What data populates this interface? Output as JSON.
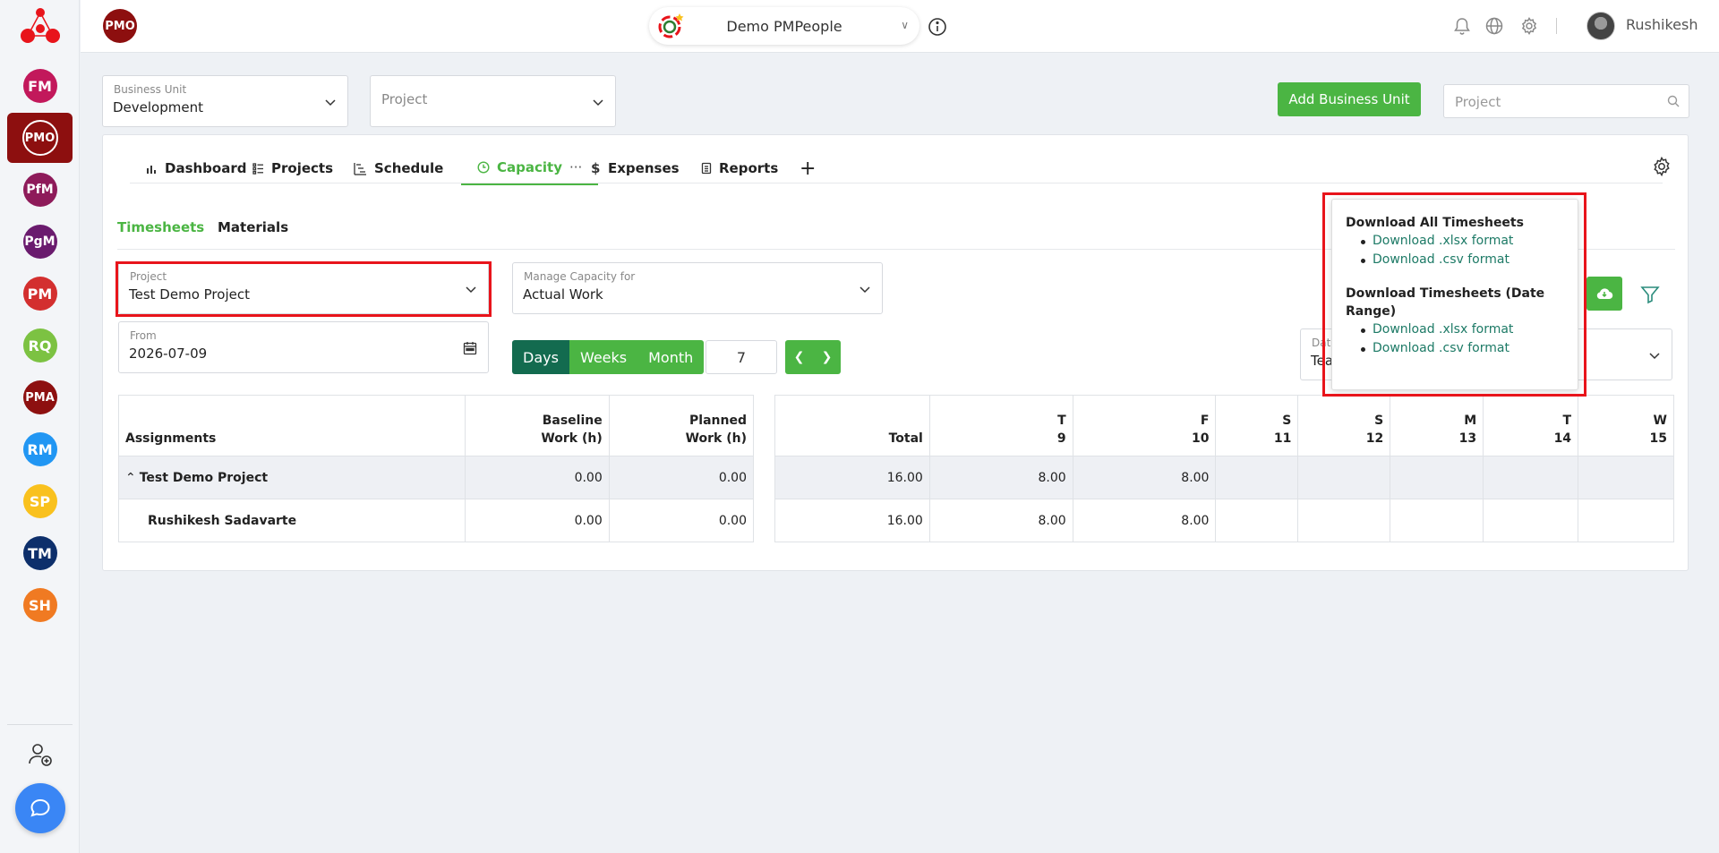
{
  "sidebar": {
    "items": [
      {
        "label": "FM",
        "color": "#c2185b"
      },
      {
        "label": "PMO",
        "color": "#8d0f0f",
        "active": true
      },
      {
        "label": "PfM",
        "color": "#8e1b5a"
      },
      {
        "label": "PgM",
        "color": "#6a1b6e"
      },
      {
        "label": "PM",
        "color": "#d32f2f"
      },
      {
        "label": "RQ",
        "color": "#7cc242"
      },
      {
        "label": "PMA",
        "color": "#8d1010"
      },
      {
        "label": "RM",
        "color": "#2196f3"
      },
      {
        "label": "SP",
        "color": "#f9c11e"
      },
      {
        "label": "TM",
        "color": "#0d2f6b"
      },
      {
        "label": "SH",
        "color": "#f07a22"
      }
    ]
  },
  "topbar": {
    "module_badge": "PMO",
    "workspace": "Demo PMPeople",
    "user_name": "Rushikesh"
  },
  "filters": {
    "business_unit_label": "Business Unit",
    "business_unit_value": "Development",
    "project_placeholder": "Project",
    "add_business_unit": "Add Business Unit",
    "search_placeholder": "Project"
  },
  "tabs": [
    {
      "label": "Dashboard"
    },
    {
      "label": "Projects"
    },
    {
      "label": "Schedule"
    },
    {
      "label": "Capacity",
      "active": true
    },
    {
      "label": "Expenses"
    },
    {
      "label": "Reports"
    }
  ],
  "subtabs": [
    "Timesheets",
    "Materials"
  ],
  "form": {
    "project_label": "Project",
    "project_value": "Test Demo Project",
    "manage_label": "Manage Capacity for",
    "manage_value": "Actual Work",
    "from_label": "From",
    "from_value": "2026-07-09",
    "period_buttons": [
      "Days",
      "Weeks",
      "Month"
    ],
    "period_count": "7",
    "date_label_partial": "Dat",
    "date_value_partial": "Tea"
  },
  "popover": {
    "section1_title": "Download All Timesheets",
    "section1_links": [
      "Download .xlsx format",
      "Download .csv format"
    ],
    "section2_title": "Download Timesheets (Date Range)",
    "section2_links": [
      "Download .xlsx format",
      "Download .csv format"
    ]
  },
  "left_table": {
    "headers": [
      "Assignments",
      "Baseline",
      "Work (h)",
      "Planned",
      "Work (h)"
    ],
    "rows": [
      {
        "name": "Test Demo Project",
        "baseline": "0.00",
        "planned": "0.00"
      },
      {
        "name": "Rushikesh Sadavarte",
        "baseline": "0.00",
        "planned": "0.00"
      }
    ]
  },
  "right_table": {
    "total_label": "Total",
    "days": [
      {
        "d": "T",
        "n": "9"
      },
      {
        "d": "F",
        "n": "10"
      },
      {
        "d": "S",
        "n": "11"
      },
      {
        "d": "S",
        "n": "12"
      },
      {
        "d": "M",
        "n": "13"
      },
      {
        "d": "T",
        "n": "14"
      },
      {
        "d": "W",
        "n": "15"
      }
    ],
    "rows": [
      {
        "total": "16.00",
        "values": [
          "8.00",
          "8.00",
          "",
          "",
          "",
          "",
          ""
        ]
      },
      {
        "total": "16.00",
        "values": [
          "8.00",
          "8.00",
          "",
          "",
          "",
          "",
          ""
        ]
      }
    ]
  }
}
